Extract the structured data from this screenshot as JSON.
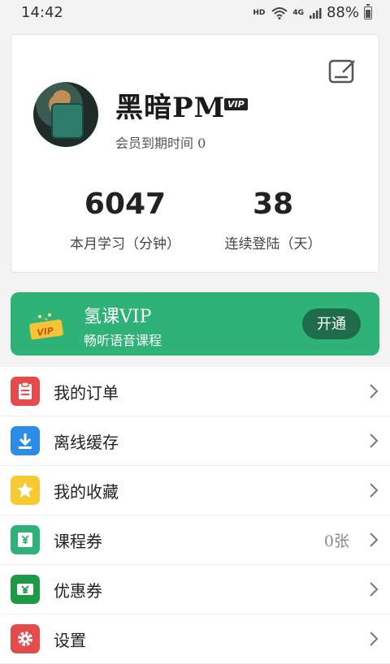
{
  "status_bar": {
    "time": "14:42",
    "hd_label": "HD",
    "network_label": "4G",
    "battery_percent": "88%"
  },
  "profile": {
    "username": "黑暗PM",
    "vip_badge": "VIP",
    "expire_text": "会员到期时间 0",
    "stats": [
      {
        "value": "6047",
        "label": "本月学习（分钟）"
      },
      {
        "value": "38",
        "label": "连续登陆（天）"
      }
    ]
  },
  "vip_banner": {
    "badge_text": "VIP",
    "title": "氢课VIP",
    "subtitle": "畅听语音课程",
    "button_label": "开通",
    "background_color": "#2fb277"
  },
  "menu": [
    {
      "label": "我的订单",
      "icon": "clipboard-icon",
      "color": "#e54b4b",
      "value": ""
    },
    {
      "label": "离线缓存",
      "icon": "download-icon",
      "color": "#2b8de8",
      "value": ""
    },
    {
      "label": "我的收藏",
      "icon": "star-icon",
      "color": "#f7c933",
      "value": ""
    },
    {
      "label": "课程券",
      "icon": "course-ticket-icon",
      "color": "#2fb277",
      "value": "0张"
    },
    {
      "label": "优惠券",
      "icon": "coupon-icon",
      "color": "#1e9a47",
      "value": ""
    },
    {
      "label": "设置",
      "icon": "gear-icon",
      "color": "#e54b4b",
      "value": ""
    }
  ]
}
